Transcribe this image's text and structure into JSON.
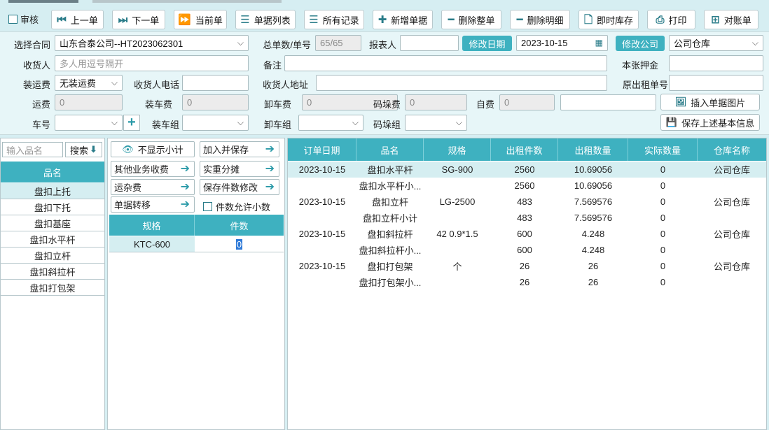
{
  "toolbar": {
    "audit": "审核",
    "prev": "上一单",
    "next": "下一单",
    "current": "当前单",
    "doc_list": "单据列表",
    "all_records": "所有记录",
    "new_doc": "新增单据",
    "delete_doc": "删除整单",
    "delete_detail": "删除明细",
    "instant_stock": "即时库存",
    "print": "打印",
    "statement": "对账单"
  },
  "form": {
    "contract_label": "选择合同",
    "contract_value": "山东合泰公司--HT2023062301",
    "total_label": "总单数/单号",
    "total_value": "65/65",
    "reporter_label": "报表人",
    "reporter_value": "",
    "modify_date_btn": "修改日期",
    "date_value": "2023-10-15",
    "modify_company_btn": "修改公司",
    "company_value": "公司仓库",
    "receiver_label": "收货人",
    "receiver_placeholder": "多人用逗号隔开",
    "remark_label": "备注",
    "deposit_label": "本张押金",
    "transport_label": "装运费",
    "transport_value": "无装运费",
    "receiver_phone_label": "收货人电话",
    "receiver_addr_label": "收货人地址",
    "orig_no_label": "原出租单号",
    "freight_label": "运费",
    "freight_value": "0",
    "loading_fee_label": "装车费",
    "loading_fee_value": "0",
    "unloading_fee_label": "卸车费",
    "unloading_fee_value": "0",
    "stacking_fee_label": "码垛费",
    "stacking_fee_value": "0",
    "self_fee_label": "自费",
    "self_fee_value": "0",
    "insert_image_btn": "插入单据图片",
    "vehicle_label": "车号",
    "loading_group_label": "装车组",
    "unloading_group_label": "卸车组",
    "stacking_group_label": "码垛组",
    "save_info_btn": "保存上述基本信息"
  },
  "left": {
    "search_placeholder": "输入品名",
    "search_btn": "搜索",
    "header": "品名",
    "items": [
      "盘扣上托",
      "盘扣下托",
      "盘扣基座",
      "盘扣水平杆",
      "盘扣立杆",
      "盘扣斜拉杆",
      "盘扣打包架"
    ]
  },
  "mid": {
    "hide_subtotal": "不显示小计",
    "add_save": "加入并保存",
    "other_fee": "其他业务收费",
    "actual_split": "实重分摊",
    "misc_fee": "运杂费",
    "save_qty": "保存件数修改",
    "doc_transfer": "单据转移",
    "allow_decimal": "件数允许小数",
    "spec_header": "规格",
    "qty_header": "件数",
    "spec_value": "KTC-600",
    "qty_value": "0"
  },
  "table": {
    "headers": [
      "订单日期",
      "品名",
      "规格",
      "出租件数",
      "出租数量",
      "实际数量",
      "仓库名称"
    ],
    "rows": [
      [
        "2023-10-15",
        "盘扣水平杆",
        "SG-900",
        "2560",
        "10.69056",
        "0",
        "公司仓库"
      ],
      [
        "",
        "盘扣水平杆小...",
        "",
        "2560",
        "10.69056",
        "0",
        ""
      ],
      [
        "2023-10-15",
        "盘扣立杆",
        "LG-2500",
        "483",
        "7.569576",
        "0",
        "公司仓库"
      ],
      [
        "",
        "盘扣立杆小计",
        "",
        "483",
        "7.569576",
        "0",
        ""
      ],
      [
        "2023-10-15",
        "盘扣斜拉杆",
        "42  0.9*1.5",
        "600",
        "4.248",
        "0",
        "公司仓库"
      ],
      [
        "",
        "盘扣斜拉杆小...",
        "",
        "600",
        "4.248",
        "0",
        ""
      ],
      [
        "2023-10-15",
        "盘扣打包架",
        "个",
        "26",
        "26",
        "0",
        "公司仓库"
      ],
      [
        "",
        "盘扣打包架小...",
        "",
        "26",
        "26",
        "0",
        ""
      ]
    ]
  }
}
